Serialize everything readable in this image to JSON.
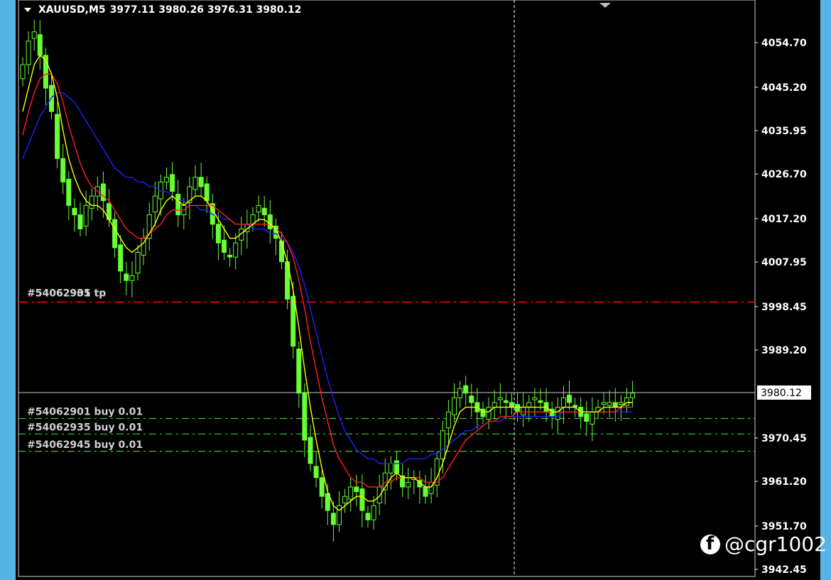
{
  "title": {
    "symbol": "XAUUSD,M5",
    "ohlc": "3977.11 3980.26 3976.31 3980.12"
  },
  "current_price_label": "3980.12",
  "price_axis": [
    "4054.70",
    "4045.20",
    "4035.95",
    "4026.70",
    "4017.20",
    "4007.95",
    "3998.45",
    "3989.20",
    "3980.12",
    "3970.45",
    "3961.20",
    "3951.70",
    "3942.45"
  ],
  "order_labels": {
    "tp": "#54062901 tp",
    "tp_overlap": "#54062935 tp",
    "buy1": "#54062901 buy 0.01",
    "buy2": "#54062935 buy 0.01",
    "buy3": "#54062945 buy 0.01"
  },
  "watermark": "@cgr1002",
  "colors": {
    "candle": "#66ff33",
    "ma_fast": "#ffff00",
    "ma_mid": "#ff2020",
    "ma_slow": "#2020ff",
    "tp_line": "#ff0000",
    "order_line": "#33cc33",
    "frame": "#57b4e6"
  },
  "icons": {
    "title_toggle": "triangle-down-icon",
    "watermark_logo": "facebook-icon"
  },
  "chart_data": {
    "type": "candlestick",
    "symbol": "XAUUSD",
    "timeframe": "M5",
    "ylim": [
      3942.45,
      4060.0
    ],
    "y_ticks": [
      4054.7,
      4045.2,
      4035.95,
      4026.7,
      4017.2,
      4007.95,
      3998.45,
      3989.2,
      3970.45,
      3961.2,
      3951.7,
      3942.45
    ],
    "current_price": 3980.12,
    "tp_level": 3999.4,
    "buy_levels": [
      3974.6,
      3971.3,
      3967.6
    ],
    "closes": [
      4050,
      4055,
      4057,
      4052,
      4045,
      4040,
      4030,
      4025,
      4020,
      4018,
      4015,
      4020,
      4022,
      4024,
      4021,
      4017,
      4011,
      4006,
      4004,
      4005,
      4010,
      4013,
      4018,
      4022,
      4025,
      4026,
      4023,
      4018,
      4020,
      4024,
      4026,
      4024,
      4021,
      4016,
      4012,
      4010,
      4009,
      4012,
      4015,
      4016,
      4018,
      4020,
      4018,
      4015,
      4013,
      4008,
      4000,
      3990,
      3980,
      3970,
      3965,
      3962,
      3958,
      3955,
      3952,
      3956,
      3958,
      3960,
      3959,
      3955,
      3953,
      3956,
      3960,
      3963,
      3965,
      3963,
      3960,
      3961,
      3962,
      3960,
      3958,
      3961,
      3966,
      3972,
      3976,
      3979,
      3981,
      3980,
      3978,
      3976,
      3975,
      3977,
      3978,
      3979,
      3978,
      3977,
      3976,
      3977,
      3978,
      3979,
      3978,
      3976,
      3975,
      3977,
      3979,
      3978,
      3977,
      3975,
      3974,
      3976,
      3977,
      3978,
      3978,
      3977,
      3978,
      3979,
      3980
    ],
    "ma_fast": [
      4040,
      4045,
      4050,
      4052,
      4051,
      4048,
      4043,
      4036,
      4030,
      4026,
      4023,
      4021,
      4020,
      4020,
      4019,
      4017,
      4015,
      4013,
      4011,
      4010,
      4011,
      4012,
      4014,
      4016,
      4019,
      4021,
      4022,
      4021,
      4020,
      4021,
      4022,
      4022,
      4021,
      4019,
      4017,
      4015,
      4013,
      4013,
      4014,
      4015,
      4016,
      4017,
      4017,
      4016,
      4015,
      4012,
      4008,
      4002,
      3994,
      3985,
      3977,
      3970,
      3964,
      3959,
      3956,
      3955,
      3956,
      3957,
      3958,
      3958,
      3957,
      3957,
      3958,
      3960,
      3962,
      3963,
      3962,
      3962,
      3962,
      3961,
      3960,
      3960,
      3962,
      3965,
      3969,
      3973,
      3976,
      3977,
      3977,
      3977,
      3976,
      3976,
      3977,
      3977,
      3977,
      3977,
      3977,
      3977,
      3977,
      3977,
      3977,
      3977,
      3976,
      3976,
      3977,
      3977,
      3977,
      3976,
      3976,
      3976,
      3976,
      3977,
      3977,
      3977,
      3977,
      3978,
      3978
    ],
    "ma_mid": [
      4035,
      4040,
      4044,
      4047,
      4048,
      4048,
      4046,
      4042,
      4037,
      4033,
      4029,
      4026,
      4024,
      4023,
      4022,
      4021,
      4019,
      4017,
      4015,
      4014,
      4013,
      4013,
      4014,
      4015,
      4016,
      4018,
      4019,
      4019,
      4019,
      4020,
      4020,
      4020,
      4020,
      4020,
      4019,
      4018,
      4017,
      4016,
      4016,
      4016,
      4016,
      4016,
      4016,
      4016,
      4015,
      4014,
      4012,
      4009,
      4004,
      3998,
      3991,
      3985,
      3979,
      3974,
      3969,
      3966,
      3964,
      3962,
      3961,
      3961,
      3960,
      3960,
      3960,
      3961,
      3961,
      3962,
      3962,
      3962,
      3962,
      3962,
      3961,
      3961,
      3961,
      3962,
      3964,
      3966,
      3968,
      3970,
      3971,
      3972,
      3973,
      3974,
      3974,
      3975,
      3975,
      3975,
      3976,
      3976,
      3976,
      3976,
      3976,
      3976,
      3976,
      3976,
      3976,
      3976,
      3976,
      3976,
      3976,
      3976,
      3976,
      3976,
      3976,
      3976,
      3977,
      3977,
      3977
    ],
    "ma_slow": [
      4030,
      4033,
      4036,
      4039,
      4041,
      4043,
      4044,
      4044,
      4043,
      4042,
      4040,
      4038,
      4036,
      4034,
      4032,
      4030,
      4028,
      4027,
      4026,
      4026,
      4025,
      4025,
      4024,
      4024,
      4023,
      4023,
      4022,
      4021,
      4021,
      4020,
      4020,
      4019,
      4019,
      4018,
      4018,
      4017,
      4017,
      4016,
      4016,
      4016,
      4015,
      4015,
      4015,
      4014,
      4014,
      4013,
      4012,
      4010,
      4007,
      4003,
      3998,
      3993,
      3988,
      3983,
      3979,
      3975,
      3972,
      3970,
      3968,
      3967,
      3966,
      3966,
      3965,
      3965,
      3965,
      3965,
      3965,
      3966,
      3966,
      3966,
      3966,
      3967,
      3967,
      3968,
      3969,
      3970,
      3971,
      3972,
      3972,
      3973,
      3973,
      3974,
      3974,
      3974,
      3975,
      3975,
      3975,
      3975,
      3975,
      3975,
      3975,
      3975,
      3975,
      3975,
      3976,
      3976,
      3976,
      3976,
      3976,
      3976,
      3976,
      3976,
      3976,
      3976,
      3976,
      3976,
      3976
    ]
  }
}
